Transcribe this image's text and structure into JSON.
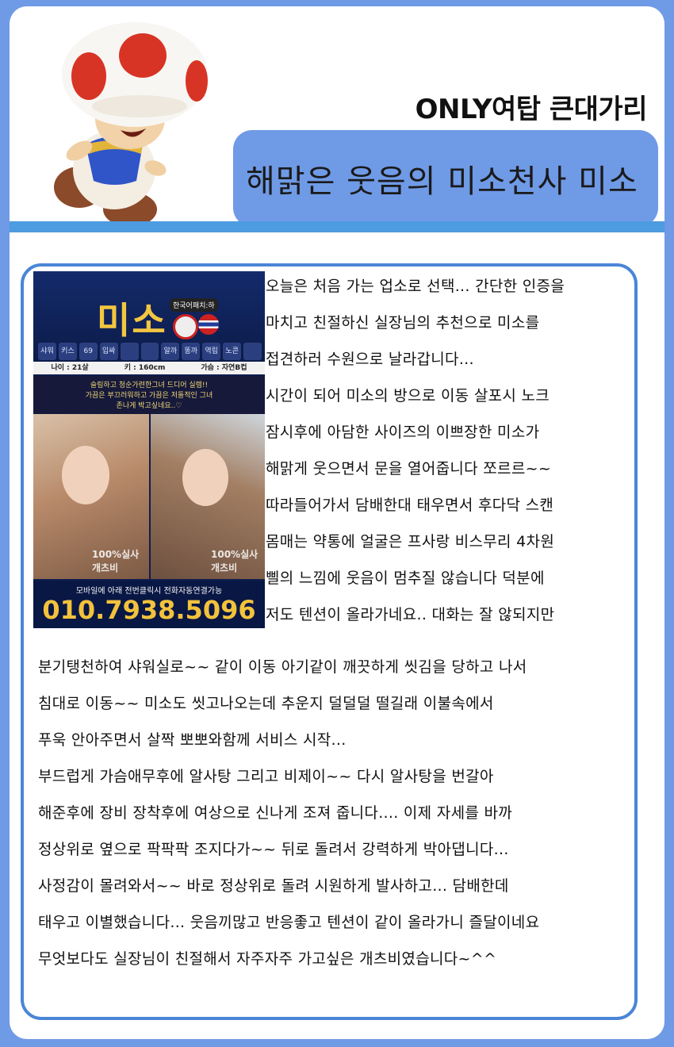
{
  "header": {
    "site_name": "ONLY여탑 큰대가리",
    "title": "해맑은 웃음의 미소천사 미소"
  },
  "ad": {
    "brand": "미소",
    "badge": "한국어패치:하",
    "tags": [
      "샤워BJ",
      "키스",
      "69",
      "입싸(문의)",
      "",
      "",
      "알까시",
      "똥까시",
      "역립",
      "노콘(문의)",
      ""
    ],
    "stats": [
      "나이 : 21살",
      "키 : 160cm",
      "가슴 : 자연B컵"
    ],
    "slogan": [
      "슬림하고 청순가련한그녀 드디어 실렘!!",
      "가끔은 부끄러워하고 가끔은 저돌적인 그녀",
      "존나게 박고싶네요..♡"
    ],
    "watermark_left": "100%실사 개츠비",
    "watermark_right": "100%실사 개츠비",
    "note": "모바일에 아래 전번클릭시 전화자동연결가능",
    "phone": "010.7938.5096"
  },
  "review": {
    "lines": [
      "오늘은 처음 가는 업소로 선택... 간단한 인증을",
      "마치고 친절하신 실장님의 추천으로 미소를",
      "접견하러 수원으로 날라갑니다...",
      "시간이 되어 미소의 방으로 이동 살포시 노크",
      "잠시후에 아담한 사이즈의 이쁘장한 미소가",
      "해맑게 웃으면서 문을 열어줍니다 쪼르르~~",
      "따라들어가서 담배한대 태우면서 후다닥 스캔",
      "몸매는 약통에 얼굴은 프사랑 비스무리 4차원",
      "삘의 느낌에 웃음이 멈추질 않습니다 덕분에",
      "저도 텐션이 올라가네요.. 대화는 잘 않되지만",
      "분기탱천하여 샤워실로~~ 같이 이동 아기같이 깨끗하게 씻김을 당하고 나서",
      "침대로 이동~~ 미소도 씻고나오는데 추운지 덜덜덜 떨길래 이불속에서",
      "푸욱 안아주면서 살짝 뽀뽀와함께 서비스 시작...",
      "부드럽게 가슴애무후에  알사탕 그리고 비제이~~  다시 알사탕을 번갈아",
      "해준후에  장비 장착후에 여상으로 신나게 조져 줍니다.... 이제 자세를 바까",
      "정상위로 옆으로 팍팍팍 조지다가~~ 뒤로 돌려서 강력하게 박아댑니다...",
      "사정감이 몰려와서~~ 바로 정상위로 돌려 시원하게 발사하고... 담배한데",
      "태우고 이별했습니다... 웃음끼많고 반응좋고 텐션이 같이 올라가니 즐달이네요",
      "무엇보다도 실장님이 친절해서 자주자주 가고싶은 개츠비였습니다~^^"
    ]
  }
}
